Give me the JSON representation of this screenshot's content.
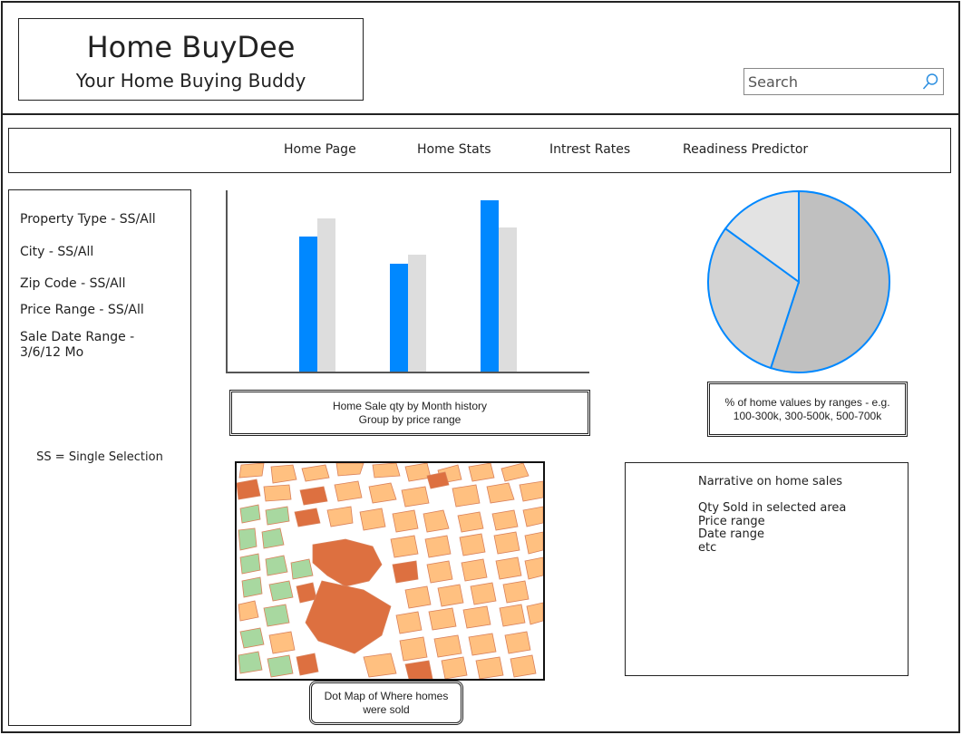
{
  "header": {
    "title": "Home BuyDee",
    "tagline": "Your Home Buying Buddy"
  },
  "search": {
    "placeholder": "Search"
  },
  "nav": {
    "items": [
      {
        "label": "Home Page"
      },
      {
        "label": "Home Stats"
      },
      {
        "label": "Intrest Rates"
      },
      {
        "label": "Readiness Predictor"
      }
    ]
  },
  "filters": {
    "items": [
      {
        "label": "Property Type - SS/All"
      },
      {
        "label": "City - SS/All"
      },
      {
        "label": "Zip Code - SS/All"
      },
      {
        "label": "Price Range - SS/All"
      },
      {
        "label": "Sale Date Range - 3/6/12 Mo"
      }
    ],
    "note": "SS = Single Selection"
  },
  "bar_caption": {
    "line1": "Home Sale qty by Month history",
    "line2": "Group by price range"
  },
  "pie_caption": "% of home values by ranges - e.g. 100-300k, 300-500k, 500-700k",
  "map_caption": {
    "line1": "Dot Map of Where homes",
    "line2": "were sold"
  },
  "narrative": {
    "title": "Narrative on home sales",
    "lines": [
      "Qty Sold in selected area",
      "Price range",
      "Date range",
      "etc"
    ]
  },
  "colors": {
    "accent": "#0088ff",
    "bar_secondary": "#dddddd",
    "pie_large": "#c0c0c0",
    "pie_medium": "#d3d3d3",
    "pie_small": "#e3e3e3",
    "map_block": "#ffc080",
    "map_park": "#a8d8a0",
    "map_landmark": "#dd7040"
  },
  "chart_data": [
    {
      "type": "bar",
      "categories": [
        "",
        "",
        ""
      ],
      "series": [
        {
          "values": [
            75,
            60,
            95
          ]
        },
        {
          "values": [
            85,
            65,
            80
          ]
        }
      ],
      "ylim": [
        0,
        100
      ],
      "grid": false
    },
    {
      "type": "pie",
      "values": [
        55,
        30,
        15
      ]
    }
  ]
}
